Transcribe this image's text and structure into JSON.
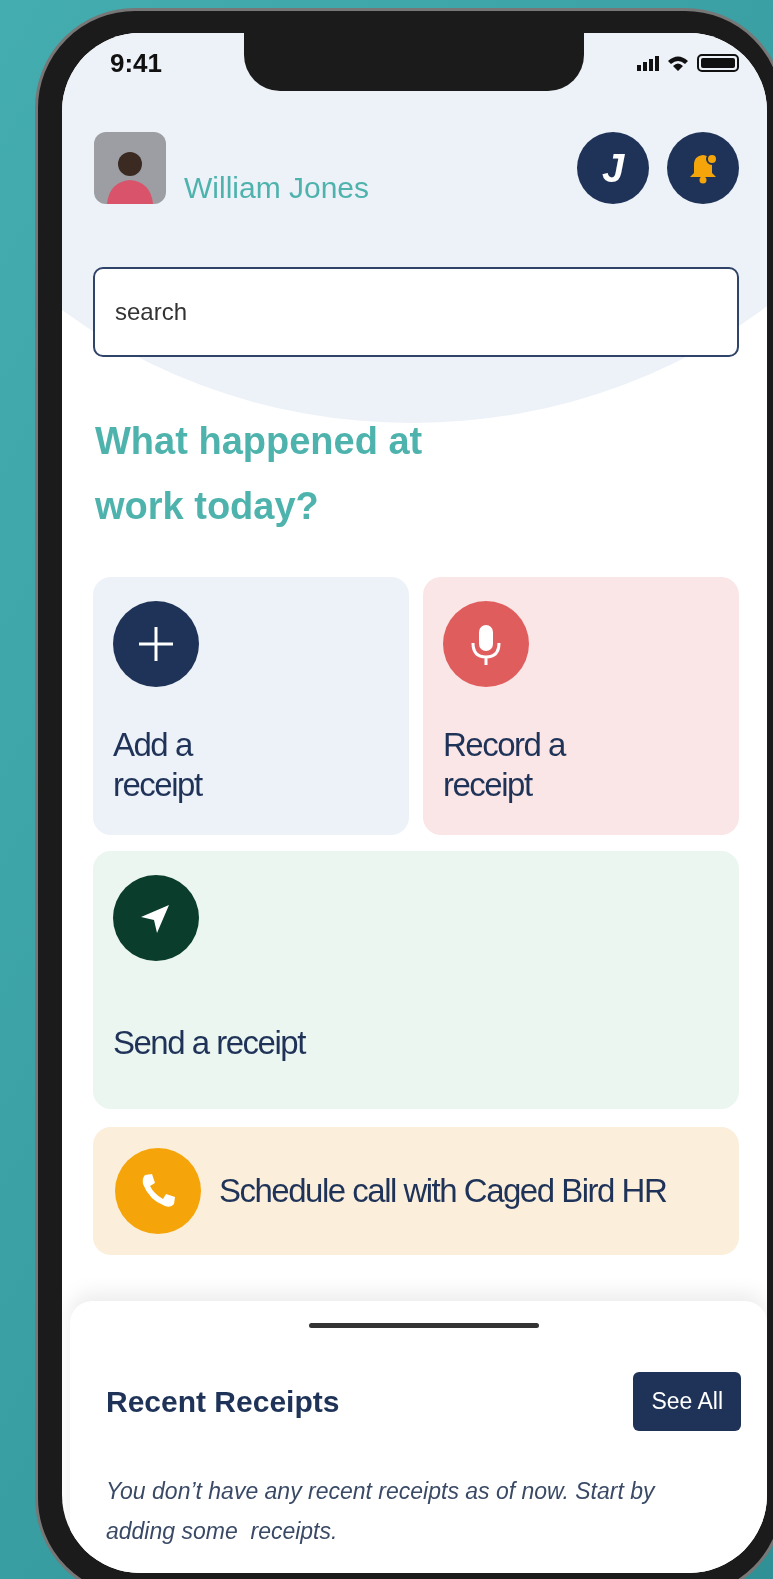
{
  "status_bar": {
    "time": "9:41"
  },
  "user": {
    "name": "William Jones",
    "initial": "J"
  },
  "search": {
    "placeholder": "search"
  },
  "heading": "What happened at work today?",
  "actions": [
    {
      "kind": "add",
      "label": "Add a receipt"
    },
    {
      "kind": "record",
      "label": "Record a receipt"
    },
    {
      "kind": "send",
      "label": "Send a receipt"
    },
    {
      "kind": "call",
      "label": "Schedule call with Caged Bird HR"
    }
  ],
  "recent": {
    "title": "Recent Receipts",
    "button": "See All",
    "empty_message": "You don’t have any recent receipts as of now. Start by adding some  receipts."
  }
}
